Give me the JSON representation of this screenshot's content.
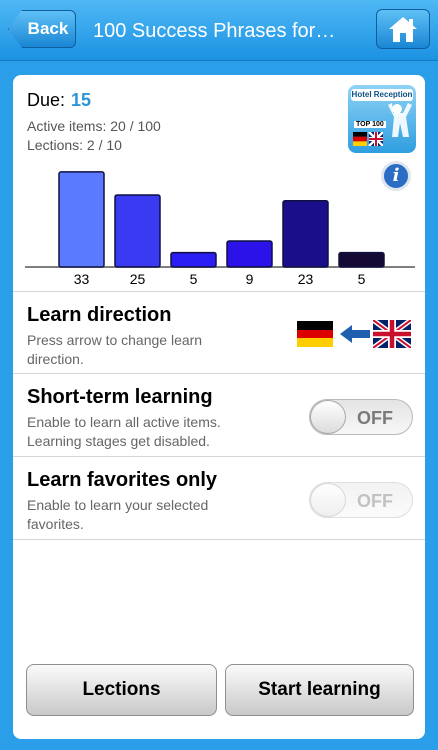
{
  "navbar": {
    "back_label": "Back",
    "title": "100 Success Phrases for…",
    "home_icon": "home-icon"
  },
  "summary": {
    "due_label": "Due:",
    "due_value": "15",
    "active_items": "Active items: 20 / 100",
    "lections": "Lections: 2 / 10"
  },
  "thumbnail": {
    "title": "Hotel Reception",
    "badge": "TOP 100"
  },
  "chart_data": {
    "type": "bar",
    "categories": [
      "33",
      "25",
      "5",
      "9",
      "23",
      "5"
    ],
    "values": [
      33,
      25,
      5,
      9,
      23,
      5
    ],
    "colors": [
      "#5a7bff",
      "#3a3af2",
      "#2b1ef5",
      "#2a12e8",
      "#1a0e8a",
      "#150a35"
    ],
    "xlabel": "",
    "ylabel": "",
    "ylim": [
      0,
      34
    ]
  },
  "learn_direction": {
    "title": "Learn direction",
    "description": "Press arrow to change learn direction.",
    "from_flag": "german-flag",
    "to_flag": "uk-flag"
  },
  "short_term": {
    "title": "Short-term learning",
    "description": "Enable to learn all active items. Learning stages get disabled.",
    "switch_label": "OFF"
  },
  "favorites": {
    "title": "Learn favorites only",
    "description": "Enable to learn your selected favorites.",
    "switch_label": "OFF"
  },
  "buttons": {
    "lections": "Lections",
    "start": "Start learning"
  },
  "colors": {
    "accent": "#2a9ee8",
    "due_value": "#2a96d6"
  }
}
